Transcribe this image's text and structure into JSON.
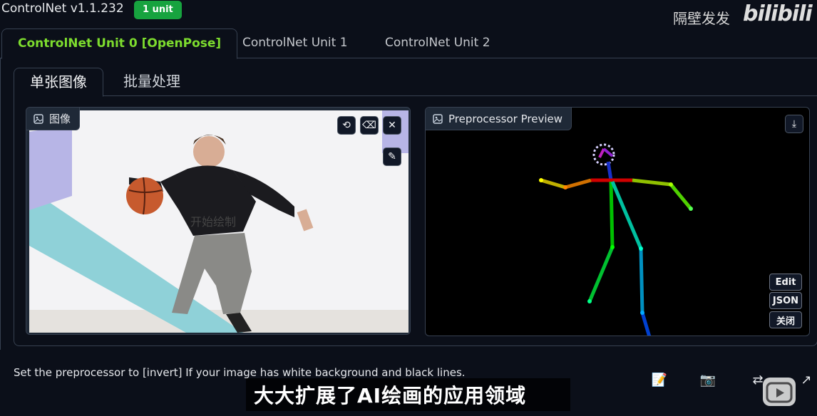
{
  "app": {
    "title": "ControlNet v1.1.232",
    "badge": "1 unit"
  },
  "watermark": {
    "text": "隔壁发发",
    "logo": "bilibili"
  },
  "unit_tabs": [
    {
      "label": "ControlNet Unit 0 [OpenPose]",
      "active": true
    },
    {
      "label": "ControlNet Unit 1",
      "active": false
    },
    {
      "label": "ControlNet Unit 2",
      "active": false
    }
  ],
  "mode_tabs": [
    {
      "label": "单张图像",
      "active": true
    },
    {
      "label": "批量处理",
      "active": false
    }
  ],
  "image_panel": {
    "label": "图像",
    "overlay_text": "开始绘制",
    "controls": [
      "undo-icon",
      "eraser-icon",
      "close-icon",
      "brush-icon"
    ]
  },
  "preview_panel": {
    "label": "Preprocessor Preview",
    "download_icon": "download-icon"
  },
  "side_buttons": {
    "edit": "Edit",
    "json": "JSON",
    "close": "关闭"
  },
  "hint": "Set the preprocessor to [invert] If your image has white background and black lines.",
  "bottom_icons": [
    "note-icon",
    "camera-icon",
    "swap-icon",
    "arrow-icon"
  ],
  "subtitle": "大大扩展了AI绘画的应用领域",
  "colors": {
    "accent_green": "#7ddc2e",
    "badge_green": "#17a33f",
    "background": "#0b0f19",
    "border": "#374151"
  }
}
